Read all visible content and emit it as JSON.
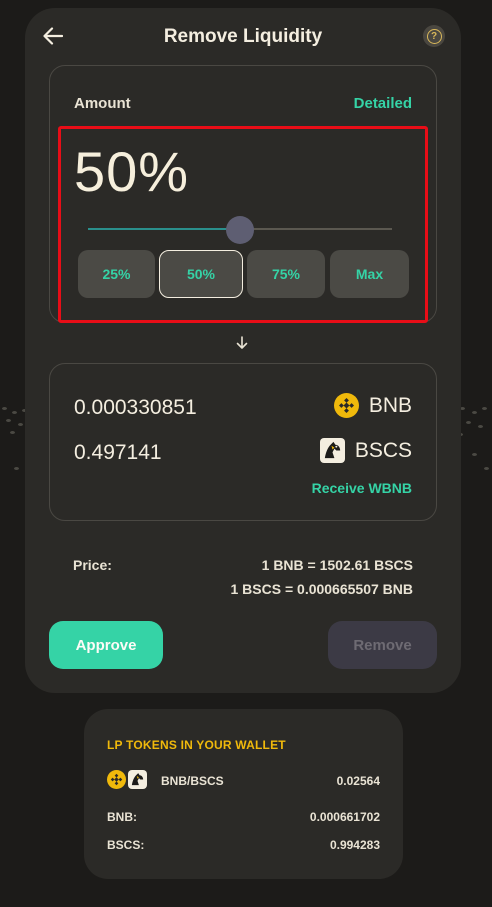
{
  "header": {
    "title": "Remove Liquidity",
    "back_icon": "arrow-left-icon",
    "help_icon": "question-icon"
  },
  "amount": {
    "label": "Amount",
    "detailed_label": "Detailed",
    "percent_display": "50%",
    "slider_fraction": 0.5,
    "buttons": [
      "25%",
      "50%",
      "75%",
      "Max"
    ],
    "active_button": "50%"
  },
  "receive": {
    "tokens": [
      {
        "amount": "0.000330851",
        "symbol": "BNB",
        "icon": "bnb-icon"
      },
      {
        "amount": "0.497141",
        "symbol": "BSCS",
        "icon": "bscs-icon"
      }
    ],
    "receive_link": "Receive WBNB"
  },
  "price": {
    "label": "Price:",
    "line1": "1 BNB = 1502.61 BSCS",
    "line2": "1 BSCS = 0.000665507 BNB"
  },
  "actions": {
    "approve": "Approve",
    "remove": "Remove"
  },
  "lp_wallet": {
    "title": "LP TOKENS IN YOUR WALLET",
    "pair": "BNB/BSCS",
    "pair_amount": "0.02564",
    "rows": [
      {
        "label": "BNB:",
        "value": "0.000661702"
      },
      {
        "label": "BSCS:",
        "value": "0.994283"
      }
    ]
  },
  "colors": {
    "accent": "#35d3a6",
    "bnb": "#f0b90b",
    "highlight": "#e80d17",
    "card": "#2b2a27",
    "background": "#1c1b19"
  }
}
